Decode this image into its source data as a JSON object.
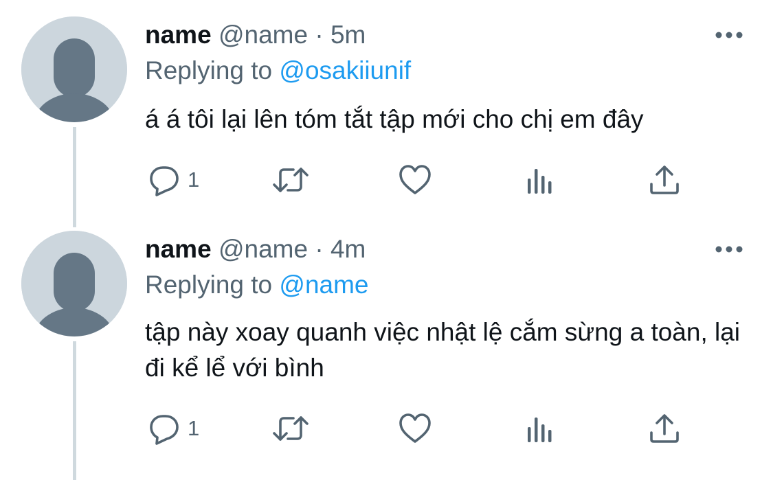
{
  "tweets": [
    {
      "display_name": "name",
      "handle": "@name",
      "dot": "·",
      "time": "5m",
      "replying_prefix": "Replying to",
      "replying_to": "@osakiiunif",
      "text": "á á tôi lại lên tóm tắt tập mới cho chị em đây",
      "reply_count": "1"
    },
    {
      "display_name": "name",
      "handle": "@name",
      "dot": "·",
      "time": "4m",
      "replying_prefix": "Replying to",
      "replying_to": "@name",
      "text": "tập này xoay quanh việc nhật lệ cắm sừng a toàn, lại đi kể lể với bình",
      "reply_count": "1"
    }
  ],
  "icons": {
    "avatar": "default-avatar-icon",
    "more": "more-dots-icon",
    "reply": "reply-icon",
    "retweet": "retweet-icon",
    "like": "heart-icon",
    "analytics": "analytics-icon",
    "share": "share-icon"
  },
  "colors": {
    "text": "#0f1419",
    "secondary": "#536471",
    "link": "#1d9bf0",
    "avatar_bg": "#ccd6dd",
    "avatar_fg": "#657786",
    "thread_line": "#cfd9de",
    "icon": "#536471"
  }
}
